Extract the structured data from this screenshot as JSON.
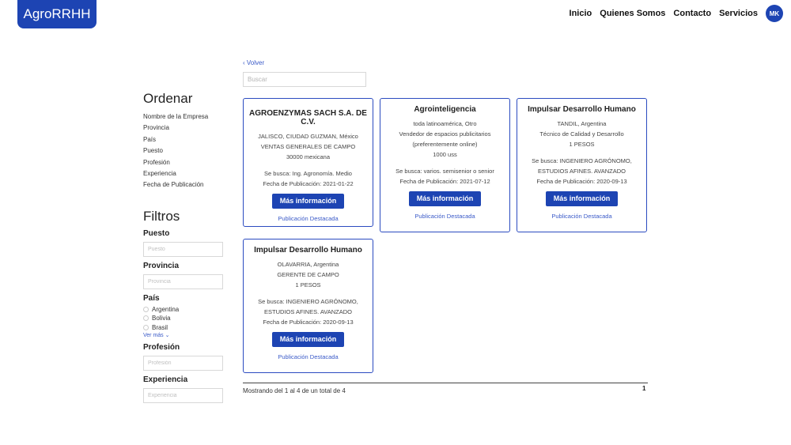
{
  "brand": {
    "name": "AgroRRHH"
  },
  "nav": {
    "items": [
      "Inicio",
      "Quienes Somos",
      "Contacto",
      "Servicios"
    ],
    "avatar_initials": "MK"
  },
  "back_label": "‹ Volver",
  "search": {
    "placeholder": "Buscar"
  },
  "sidebar": {
    "sort_title": "Ordenar",
    "sort_items": [
      "Nombre de la Empresa",
      "Provincia",
      "País",
      "Puesto",
      "Profesión",
      "Experiencia",
      "Fecha de Publicación"
    ],
    "filters_title": "Filtros",
    "puesto": {
      "label": "Puesto",
      "placeholder": "Puesto"
    },
    "provincia": {
      "label": "Provincia",
      "placeholder": "Provincia"
    },
    "pais": {
      "label": "País",
      "options": [
        "Argentina",
        "Bolivia",
        "Brasil"
      ],
      "more": "Ver más ⌄"
    },
    "profesion": {
      "label": "Profesión",
      "placeholder": "Profesión"
    },
    "experiencia": {
      "label": "Experiencia",
      "placeholder": "Experiencia"
    }
  },
  "cards": [
    {
      "title": "AGROENZYMAS SACH S.A. DE C.V.",
      "details": [
        "JALISCO, CIUDAD GUZMAN, México",
        "VENTAS GENERALES DE CAMPO",
        "30000 mexicana"
      ],
      "search": [
        "Se busca: Ing. Agronomía. Medio"
      ],
      "date": "Fecha de Publicación: 2021-01-22",
      "button": "Más información",
      "featured": "Publicación Destacada"
    },
    {
      "title": "Agrointeligencia",
      "details": [
        "toda latinoamérica, Otro",
        "Vendedor de espacios publicitarios",
        "(preferentemente online)",
        "1000 uss"
      ],
      "search": [
        "Se busca: varios. semisenior o senior"
      ],
      "date": "Fecha de Publicación: 2021-07-12",
      "button": "Más información",
      "featured": "Publicación Destacada"
    },
    {
      "title": "Impulsar Desarrollo Humano",
      "details": [
        "TANDIL, Argentina",
        "Técnico de Calidad y Desarrollo",
        "1 PESOS"
      ],
      "search": [
        "Se busca: INGENIERO AGRÓNOMO,",
        "ESTUDIOS AFINES. AVANZADO"
      ],
      "date": "Fecha de Publicación: 2020-09-13",
      "button": "Más información",
      "featured": "Publicación Destacada"
    },
    {
      "title": "Impulsar Desarrollo Humano",
      "details": [
        "OLAVARRIA, Argentina",
        "GERENTE DE CAMPO",
        "1 PESOS"
      ],
      "search": [
        "Se busca: INGENIERO AGRÓNOMO,",
        "ESTUDIOS AFINES. AVANZADO"
      ],
      "date": "Fecha de Publicación: 2020-09-13",
      "button": "Más información",
      "featured": "Publicación Destacada"
    }
  ],
  "pagination": {
    "summary": "Mostrando del 1 al 4 de un total de 4",
    "current_page": "1"
  },
  "colors": {
    "primary": "#1d44b3",
    "link": "#3a5ac8",
    "card_border": "#2b4bc0"
  }
}
